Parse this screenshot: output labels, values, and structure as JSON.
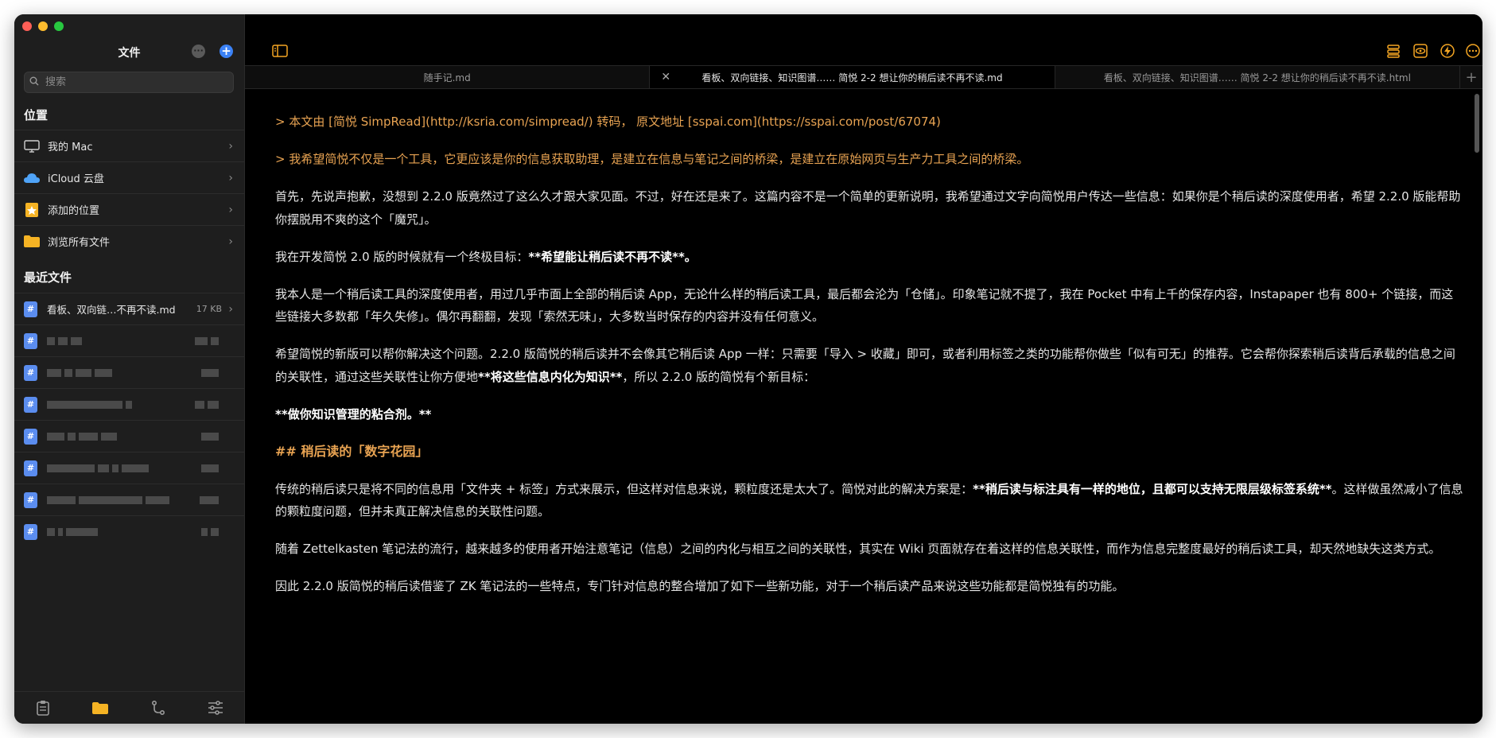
{
  "sidebar": {
    "title": "文件",
    "search_placeholder": "搜索",
    "location_header": "位置",
    "locations": [
      {
        "label": "我的 Mac",
        "icon": "monitor-icon"
      },
      {
        "label": "iCloud 云盘",
        "icon": "cloud-icon"
      },
      {
        "label": "添加的位置",
        "icon": "star-folder-icon"
      },
      {
        "label": "浏览所有文件",
        "icon": "folder-icon"
      }
    ],
    "recent_header": "最近文件",
    "recent_files": [
      {
        "label": "看板、双向链…不再不读.md",
        "size": "17 KB"
      }
    ]
  },
  "tabs": [
    {
      "label": "随手记.md",
      "active": false
    },
    {
      "label": "看板、双向链接、知识图谱…… 简悦 2-2 想让你的稍后读不再不读.md",
      "active": true
    },
    {
      "label": "看板、双向链接、知识图谱…… 简悦 2-2 想让你的稍后读不再不读.html",
      "active": false
    }
  ],
  "editor": {
    "p1": "> 本文由 [简悦 SimpRead](http://ksria.com/simpread/) 转码， 原文地址 [sspai.com](https://sspai.com/post/67074)",
    "p2": "> 我希望简悦不仅是一个工具，它更应该是你的信息获取助理，是建立在信息与笔记之间的桥梁，是建立在原始网页与生产力工具之间的桥梁。",
    "p3": "首先，先说声抱歉，没想到 2.2.0 版竟然过了这么久才跟大家见面。不过，好在还是来了。这篇内容不是一个简单的更新说明，我希望通过文字向简悦用户传达一些信息：如果你是个稍后读的深度使用者，希望 2.2.0 版能帮助你摆脱用不爽的这个「魔咒」。",
    "p4a": "我在开发简悦 2.0 版的时候就有一个终极目标：",
    "p4b": "**希望能让稍后读不再不读**。",
    "p5": "我本人是一个稍后读工具的深度使用者，用过几乎市面上全部的稍后读 App，无论什么样的稍后读工具，最后都会沦为「仓储」。印象笔记就不提了，我在 Pocket 中有上千的保存内容，Instapaper 也有 800+ 个链接，而这些链接大多数都「年久失修」。偶尔再翻翻，发现「索然无味」，大多数当时保存的内容并没有任何意义。",
    "p6a": "希望简悦的新版可以帮你解决这个问题。2.2.0 版简悦的稍后读并不会像其它稍后读 App 一样：只需要「导入 > 收藏」即可，或者利用标签之类的功能帮你做些「似有可无」的推荐。它会帮你探索稍后读背后承载的信息之间的关联性，通过这些关联性让你方便地",
    "p6b": "**将这些信息内化为知识**",
    "p6c": "，所以 2.2.0 版的简悦有个新目标：",
    "p7": "**做你知识管理的粘合剂。**",
    "h2": "## 稍后读的「数字花园」",
    "p8a": "传统的稍后读只是将不同的信息用「文件夹 + 标签」方式来展示，但这样对信息来说，颗粒度还是太大了。简悦对此的解决方案是：",
    "p8b": "**稍后读与标注具有一样的地位，且都可以支持无限层级标签系统**",
    "p8c": "。这样做虽然减小了信息的颗粒度问题，但并未真正解决信息的关联性问题。",
    "p9": "随着 Zettelkasten 笔记法的流行，越来越多的使用者开始注意笔记（信息）之间的内化与相互之间的关联性，其实在 Wiki 页面就存在着这样的信息关联性，而作为信息完整度最好的稍后读工具，却天然地缺失这类方式。",
    "p10": "因此 2.2.0 版简悦的稍后读借鉴了 ZK 笔记法的一些特点，专门针对信息的整合增加了如下一些新功能，对于一个稍后读产品来说这些功能都是简悦独有的功能。"
  },
  "colors": {
    "accent": "#e8a352",
    "sidebar_bg": "#1e1e1e",
    "editor_bg": "#000000",
    "icon_accent": "#f5a623"
  }
}
